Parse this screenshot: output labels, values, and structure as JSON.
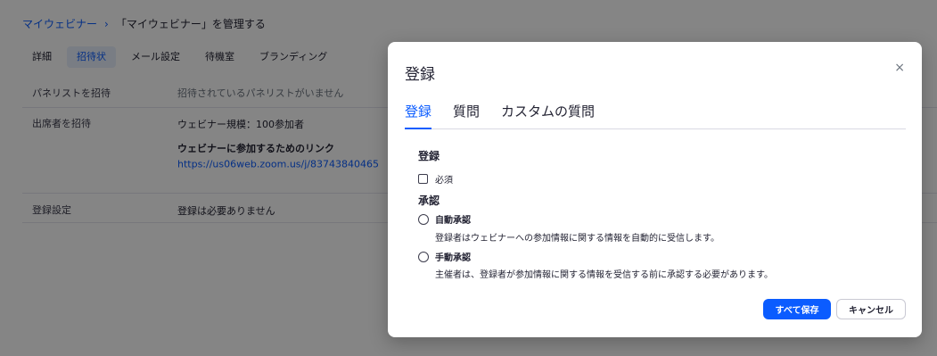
{
  "breadcrumb": {
    "parent": "マイウェビナー",
    "separator": "›",
    "current": "「マイウェビナー」を管理する"
  },
  "tabs": [
    {
      "label": "詳細"
    },
    {
      "label": "招待状"
    },
    {
      "label": "メール設定"
    },
    {
      "label": "待機室"
    },
    {
      "label": "ブランディング"
    }
  ],
  "rows": {
    "panelists": {
      "label": "パネリストを招待",
      "value": "招待されているパネリストがいません"
    },
    "attendees": {
      "label": "出席者を招待",
      "scale": "ウェビナー規模：100参加者",
      "link_heading": "ウェビナーに参加するためのリンク",
      "link_url": "https://us06web.zoom.us/j/83743840465"
    },
    "registration": {
      "label": "登録設定",
      "value": "登録は必要ありません"
    }
  },
  "modal": {
    "title": "登録",
    "close": "×",
    "tabs": [
      {
        "label": "登録"
      },
      {
        "label": "質問"
      },
      {
        "label": "カスタムの質問"
      }
    ],
    "registration_section": "登録",
    "required_label": "必須",
    "approval_section": "承認",
    "auto_label": "自動承認",
    "auto_desc": "登録者はウェビナーへの参加情報に関する情報を自動的に受信します。",
    "manual_label": "手動承認",
    "manual_desc": "主催者は、登録者が参加情報に関する情報を受信する前に承認する必要があります。",
    "save_label": "すべて保存",
    "cancel_label": "キャンセル"
  },
  "colors": {
    "accent": "#0b5cff",
    "overlay": "rgba(0,0,0,0.48)"
  }
}
